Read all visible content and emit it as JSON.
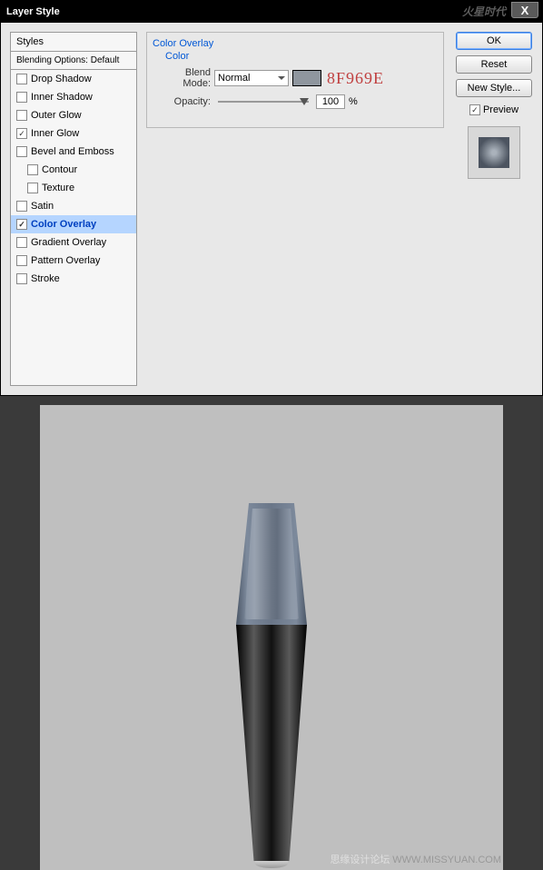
{
  "dialog": {
    "title": "Layer Style",
    "watermark": "火星时代"
  },
  "styles": {
    "header": "Styles",
    "blending": "Blending Options: Default",
    "items": [
      {
        "label": "Drop Shadow",
        "checked": false,
        "indent": false
      },
      {
        "label": "Inner Shadow",
        "checked": false,
        "indent": false
      },
      {
        "label": "Outer Glow",
        "checked": false,
        "indent": false
      },
      {
        "label": "Inner Glow",
        "checked": true,
        "indent": false
      },
      {
        "label": "Bevel and Emboss",
        "checked": false,
        "indent": false
      },
      {
        "label": "Contour",
        "checked": false,
        "indent": true
      },
      {
        "label": "Texture",
        "checked": false,
        "indent": true
      },
      {
        "label": "Satin",
        "checked": false,
        "indent": false
      },
      {
        "label": "Color Overlay",
        "checked": true,
        "indent": false,
        "selected": true
      },
      {
        "label": "Gradient Overlay",
        "checked": false,
        "indent": false
      },
      {
        "label": "Pattern Overlay",
        "checked": false,
        "indent": false
      },
      {
        "label": "Stroke",
        "checked": false,
        "indent": false
      }
    ]
  },
  "overlay": {
    "section_title": "Color Overlay",
    "sub_title": "Color",
    "blend_mode_label": "Blend Mode:",
    "blend_mode_value": "Normal",
    "color_hex": "8F969E",
    "opacity_label": "Opacity:",
    "opacity_value": "100",
    "opacity_unit": "%"
  },
  "buttons": {
    "ok": "OK",
    "reset": "Reset",
    "new_style": "New Style...",
    "preview": "Preview"
  },
  "footer": {
    "credit1": "思缘设计论坛",
    "credit2": "WWW.MISSYUAN.COM"
  }
}
